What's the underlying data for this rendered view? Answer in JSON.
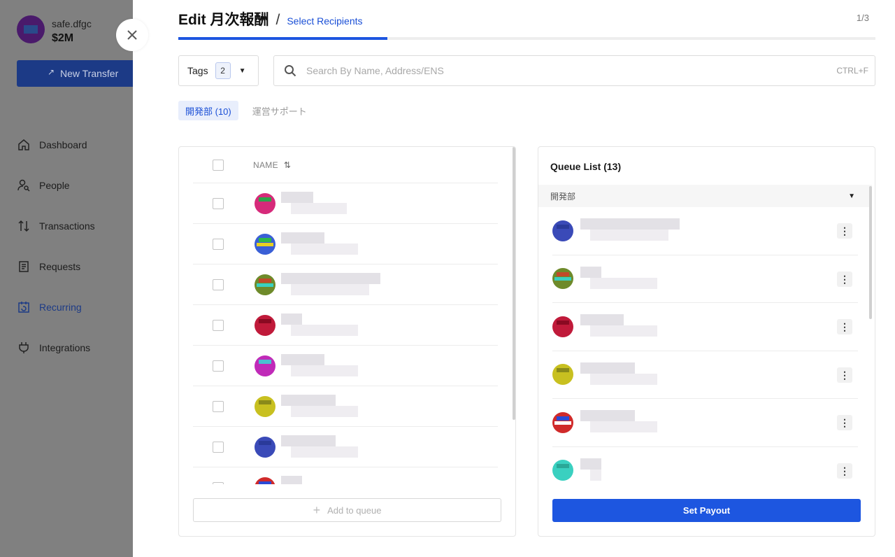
{
  "account": {
    "name": "safe.dfgc",
    "balance": "$2M"
  },
  "new_transfer_label": "New Transfer",
  "nav": [
    {
      "label": "Dashboard",
      "icon": "home-icon"
    },
    {
      "label": "People",
      "icon": "person-search-icon"
    },
    {
      "label": "Transactions",
      "icon": "arrows-updown-icon"
    },
    {
      "label": "Requests",
      "icon": "document-icon"
    },
    {
      "label": "Recurring",
      "icon": "calendar-recurring-icon",
      "active": true
    },
    {
      "label": "Integrations",
      "icon": "plug-icon"
    }
  ],
  "header": {
    "title": "Edit 月次報酬",
    "separator": "/",
    "step_label": "Select Recipients",
    "step_count": "1/3"
  },
  "progress": {
    "fraction": 0.3
  },
  "tags": {
    "label": "Tags",
    "count": "2"
  },
  "search": {
    "placeholder": "Search By Name, Address/ENS",
    "shortcut": "CTRL+F",
    "value": ""
  },
  "filter_tabs": [
    {
      "label": "開発部 (10)",
      "active": true
    },
    {
      "label": "運営サポート",
      "active": false
    }
  ],
  "list": {
    "column_name": "NAME",
    "rows_identicon_colors": [
      [
        "#d62a7a",
        "#2ea34a",
        "#d62a7a"
      ],
      [
        "#3a5fd6",
        "#2eb84a",
        "#e8d020"
      ],
      [
        "#6e8a2a",
        "#c04a2a",
        "#3ad0c0"
      ],
      [
        "#c01a3a",
        "#8a0a22",
        "#c01a3a"
      ],
      [
        "#c02ab8",
        "#4ac0d0",
        "#c02ab8"
      ],
      [
        "#c8c020",
        "#8a8a1a",
        "#c8c020"
      ],
      [
        "#3a4ab8",
        "#2a3a9a",
        "#3a4ab8"
      ],
      [
        "#d02a2a",
        "#2a4ad6",
        "#ffffff"
      ]
    ],
    "add_to_queue_label": "Add to queue"
  },
  "queue": {
    "title": "Queue List (13)",
    "group_label": "開発部",
    "rows_identicon_colors": [
      [
        "#3a4ab8",
        "#2a3a9a",
        "#3a4ab8"
      ],
      [
        "#6e8a2a",
        "#c04a2a",
        "#3ad0c0"
      ],
      [
        "#c01a3a",
        "#8a0a22",
        "#c01a3a"
      ],
      [
        "#c8c020",
        "#8a8a1a",
        "#c8c020"
      ],
      [
        "#d02a2a",
        "#2a4ad6",
        "#ffffff"
      ],
      [
        "#3ad0c0",
        "#2aa898",
        "#3ad0c0"
      ]
    ],
    "set_payout_label": "Set Payout"
  },
  "colors": {
    "accent": "#1d56e0",
    "dim_overlay": "#808080",
    "nav_active": "#1c3a86"
  }
}
